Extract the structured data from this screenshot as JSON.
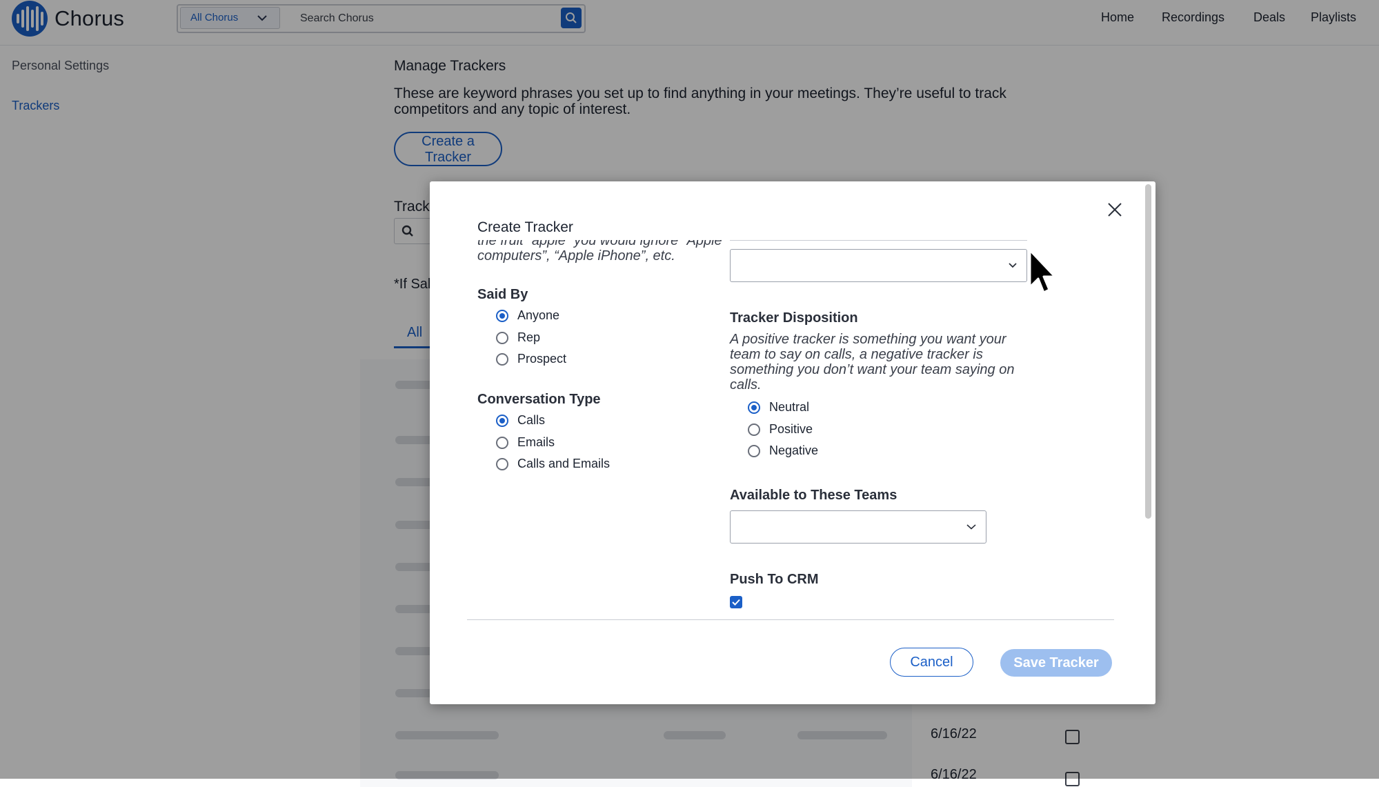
{
  "app": {
    "name": "Chorus"
  },
  "search": {
    "scope": "All Chorus",
    "placeholder": "Search Chorus"
  },
  "nav": {
    "items": [
      "Home",
      "Recordings",
      "Deals",
      "Playlists"
    ]
  },
  "sidebar": {
    "title": "Personal Settings",
    "items": [
      {
        "label": "Trackers"
      }
    ]
  },
  "main": {
    "title": "Manage Trackers",
    "description": "These are keyword phrases you set up to find anything in your meetings. They’re useful to track competitors and any topic of interest.",
    "create_button": "Create a Tracker",
    "trackers_label": "Track",
    "note": "*If Sal",
    "tab_all": "All",
    "rows": [
      {
        "date": "6/16/22"
      },
      {
        "date": "6/16/22"
      }
    ]
  },
  "modal": {
    "title": "Create Tracker",
    "note_text": "the fruit “apple” you would ignore “Apple computers”, “Apple iPhone”, etc.",
    "said_by": {
      "label": "Said By",
      "options": [
        "Anyone",
        "Rep",
        "Prospect"
      ],
      "selected": "Anyone"
    },
    "conversation_type": {
      "label": "Conversation Type",
      "options": [
        "Calls",
        "Emails",
        "Calls and Emails"
      ],
      "selected": "Calls"
    },
    "tracker_disposition": {
      "label": "Tracker Disposition",
      "description": "A positive tracker is something you want your team to say on calls, a negative tracker is something you don’t want your team saying on calls.",
      "options": [
        "Neutral",
        "Positive",
        "Negative"
      ],
      "selected": "Neutral"
    },
    "available_teams": {
      "label": "Available to These Teams",
      "value": ""
    },
    "push_to_crm": {
      "label": "Push To CRM",
      "checked": true
    },
    "cancel_button": "Cancel",
    "save_button": "Save Tracker"
  },
  "colors": {
    "brand": "#1b5fc7",
    "save_disabled": "#9dbfef"
  }
}
